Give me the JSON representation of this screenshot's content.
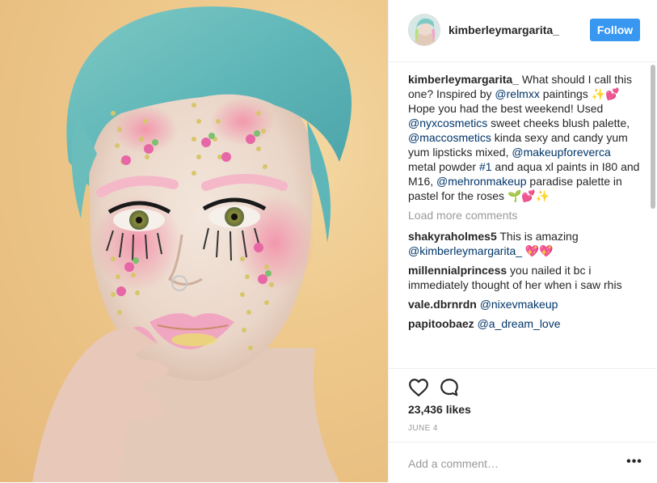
{
  "header": {
    "username": "kimberleymargarita_",
    "follow_label": "Follow"
  },
  "caption": {
    "user": "kimberleymargarita_",
    "t1": " What should I call this one? Inspired by ",
    "m1": "@relmxx",
    "t2": " paintings ✨💕Hope you had the best weekend! Used ",
    "m2": "@nyxcosmetics",
    "t3": " sweet cheeks blush palette, ",
    "m3": "@maccosmetics",
    "t4": " kinda sexy and candy yum yum lipsticks mixed, ",
    "m4": "@makeupforeverca",
    "t5": " metal powder ",
    "m5": "#1",
    "t6": " and aqua xl paints in I80 and M16, ",
    "m6": "@mehronmakeup",
    "t7": " paradise palette in pastel for the roses 🌱💕✨"
  },
  "load_more": "Load more comments",
  "comments": [
    {
      "user": "shakyraholmes5",
      "text": " This is amazing ",
      "mention": "@kimberleymargarita_",
      "tail": " 💖💖"
    },
    {
      "user": "millennialprincess",
      "text": " you nailed it bc i immediately thought of her when i saw rhis",
      "mention": "",
      "tail": ""
    },
    {
      "user": "vale.dbrnrdn",
      "text": " ",
      "mention": "@nixevmakeup",
      "tail": ""
    },
    {
      "user": "papitoobaez",
      "text": " ",
      "mention": "@a_dream_love",
      "tail": ""
    }
  ],
  "icons": {
    "like": "heart-outline",
    "comment": "speech-bubble-outline",
    "more": "ellipsis"
  },
  "likes": "23,436 likes",
  "date": "JUNE 4",
  "comment_input": {
    "placeholder": "Add a comment…"
  },
  "more_glyph": "•••",
  "colors": {
    "accent": "#3897f0",
    "mention": "#003569",
    "muted": "#999999"
  }
}
